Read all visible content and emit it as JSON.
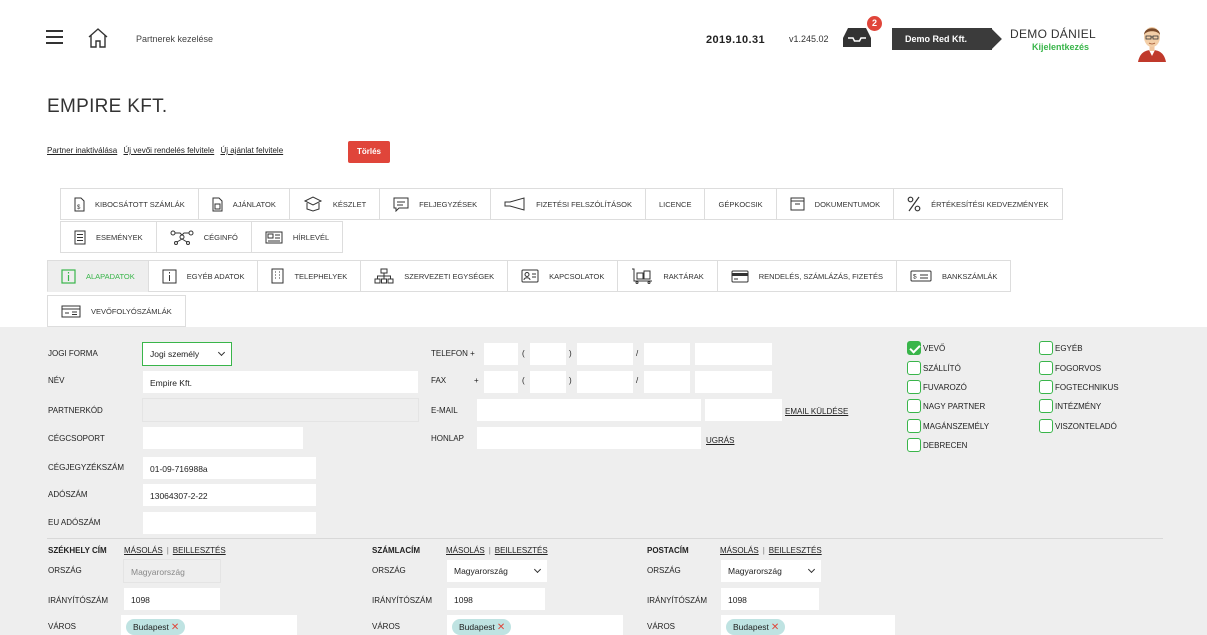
{
  "header": {
    "breadcrumb": "Partnerek kezelése",
    "date": "2019.10.31",
    "version": "v1.245.02",
    "inbox_badge": "2",
    "company": "Demo Red Kft.",
    "user_name": "DEMO DÁNIEL",
    "logout": "Kijelentkezés"
  },
  "page": {
    "title": "EMPIRE KFT.",
    "actions": [
      "Partner inaktiválása",
      "Új vevői rendelés felvitele",
      "Új ajánlat felvitele"
    ],
    "delete_label": "Törlés"
  },
  "tabs_row1": [
    {
      "label": "Kibocsátott számlák",
      "icon": "invoice-icon"
    },
    {
      "label": "Ajánlatok",
      "icon": "offer-icon"
    },
    {
      "label": "Készlet",
      "icon": "box-icon"
    },
    {
      "label": "Feljegyzések",
      "icon": "note-icon"
    },
    {
      "label": "Fizetési felszólítások",
      "icon": "megaphone-icon"
    },
    {
      "label": "Licence",
      "icon": ""
    },
    {
      "label": "Gépkocsik",
      "icon": ""
    },
    {
      "label": "Dokumentumok",
      "icon": "folder-icon"
    },
    {
      "label": "Értékesítési kedvezmények",
      "icon": "percent-icon"
    }
  ],
  "tabs_row2": [
    {
      "label": "Események",
      "icon": "list-icon"
    },
    {
      "label": "Céginfó",
      "icon": "network-icon"
    },
    {
      "label": "Hírlevél",
      "icon": "newsletter-icon"
    }
  ],
  "tabs_row3": [
    {
      "label": "Alapadatok",
      "icon": "info-icon",
      "active": true
    },
    {
      "label": "Egyéb adatok",
      "icon": "info-icon"
    },
    {
      "label": "Telephelyek",
      "icon": "building-icon"
    },
    {
      "label": "Szervezeti egységek",
      "icon": "org-chart-icon"
    },
    {
      "label": "Kapcsolatok",
      "icon": "contact-card-icon"
    },
    {
      "label": "Raktárak",
      "icon": "warehouse-icon"
    },
    {
      "label": "Rendelés, számlázás, fizetés",
      "icon": "card-icon"
    },
    {
      "label": "Bankszámlák",
      "icon": "bank-icon"
    }
  ],
  "tabs_row4": [
    {
      "label": "Vevőfolyószámlák",
      "icon": "ledger-icon"
    }
  ],
  "form": {
    "jogi_forma_label": "JOGI FORMA",
    "jogi_forma_value": "Jogi személy",
    "nev_label": "NÉV",
    "nev_value": "Empire Kft.",
    "partnerkod_label": "PARTNERKÓD",
    "cegcsoport_label": "CÉGCSOPORT",
    "cegjegyzekszam_label": "CÉGJEGYZÉKSZÁM",
    "cegjegyzekszam_value": "01-09-716988a",
    "adoszam_label": "ADÓSZÁM",
    "adoszam_value": "13064307-2-22",
    "eu_adoszam_label": "EU ADÓSZÁM",
    "telefon_label": "TELEFON",
    "fax_label": "FAX",
    "plus": "+",
    "paren_open": "(",
    "paren_close": ")",
    "slash": "/",
    "email_label": "E-MAIL",
    "email_send": "EMAIL KÜLDÉSE",
    "honlap_label": "HONLAP",
    "ugras": "UGRÁS"
  },
  "checkboxes_col1": [
    {
      "label": "VEVŐ",
      "checked": true
    },
    {
      "label": "SZÁLLÍTÓ",
      "checked": false
    },
    {
      "label": "FUVAROZÓ",
      "checked": false
    },
    {
      "label": "NAGY PARTNER",
      "checked": false
    },
    {
      "label": "MAGÁNSZEMÉLY",
      "checked": false
    },
    {
      "label": "DEBRECEN",
      "checked": false
    }
  ],
  "checkboxes_col2": [
    {
      "label": "EGYÉB",
      "checked": false
    },
    {
      "label": "FOGORVOS",
      "checked": false
    },
    {
      "label": "FOGTECHNIKUS",
      "checked": false
    },
    {
      "label": "INTÉZMÉNY",
      "checked": false
    },
    {
      "label": "VISZONTELADÓ",
      "checked": false
    }
  ],
  "address": {
    "copy": "MÁSOLÁS",
    "paste": "BEILLESZTÉS",
    "sep": "|",
    "orszag_label": "ORSZÁG",
    "irsz_label": "IRÁNYÍTÓSZÁM",
    "varos_label": "VÁROS",
    "remove_glyph": "✕",
    "szekhely": {
      "title": "SZÉKHELY CÍM",
      "country": "Magyarország",
      "zip": "1098",
      "city": "Budapest"
    },
    "szamla": {
      "title": "SZÁMLACÍM",
      "country": "Magyarország",
      "zip": "1098",
      "city": "Budapest"
    },
    "posta": {
      "title": "POSTACÍM",
      "country": "Magyarország",
      "zip": "1098",
      "city": "Budapest"
    }
  },
  "colors": {
    "accent": "#39b54a",
    "danger": "#e0453a",
    "dark": "#3b3b3b",
    "tag": "#bfe3e2"
  }
}
